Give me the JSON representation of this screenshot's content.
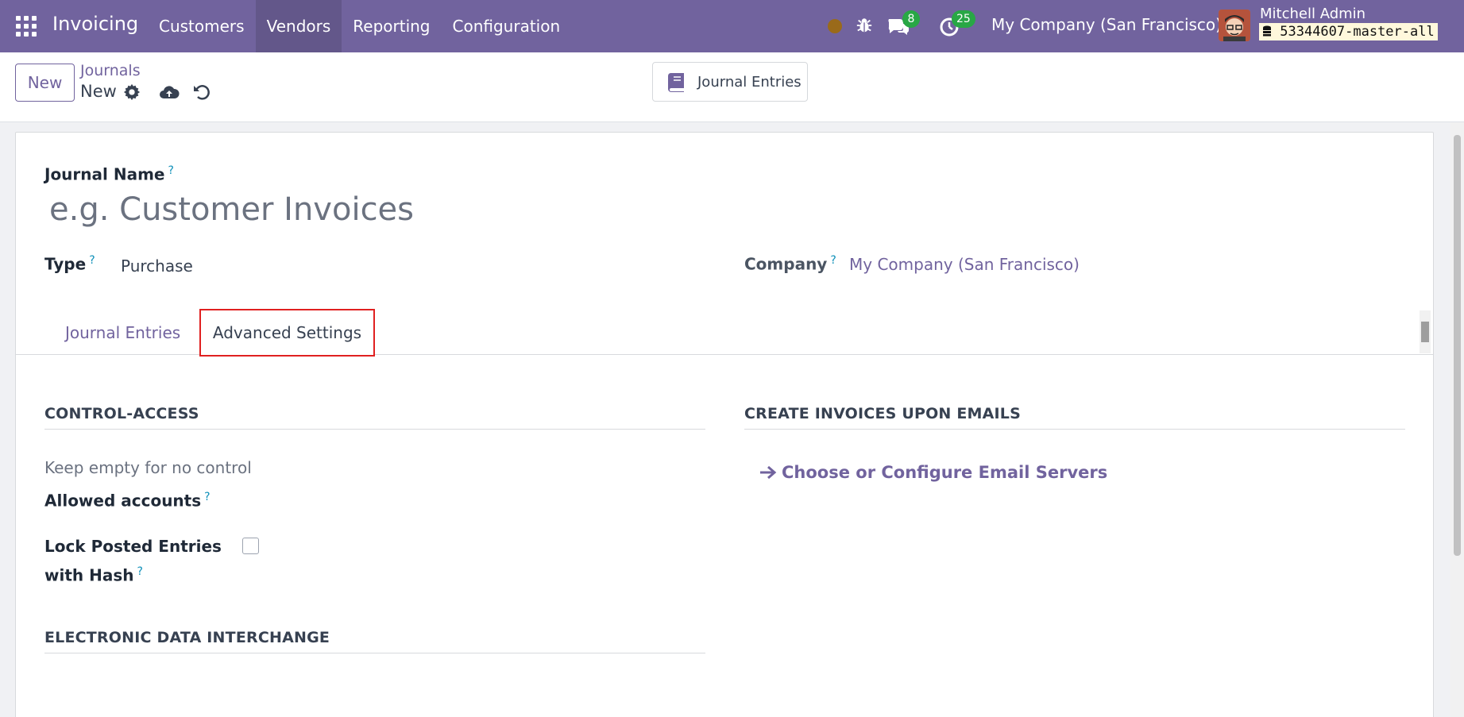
{
  "navbar": {
    "app_name": "Invoicing",
    "menu": [
      {
        "label": "Customers",
        "active": false
      },
      {
        "label": "Vendors",
        "active": true
      },
      {
        "label": "Reporting",
        "active": false
      },
      {
        "label": "Configuration",
        "active": false
      }
    ],
    "messages_count": "8",
    "activities_count": "25",
    "company": "My Company (San Francisco)",
    "user_name": "Mitchell Admin",
    "database": "53344607-master-all",
    "accent_color": "#71639e",
    "icons": [
      "apps-grid-icon",
      "status-dot-icon",
      "bug-icon",
      "chat-icon",
      "activity-clock-icon",
      "database-icon"
    ]
  },
  "control_panel": {
    "new_label": "New",
    "breadcrumb": "Journals",
    "record_name": "New",
    "smart_button_label": "Journal Entries",
    "icons": [
      "gear-icon",
      "cloud-upload-icon",
      "undo-icon",
      "book-icon"
    ]
  },
  "form": {
    "journal_name_label": "Journal Name",
    "journal_name_placeholder": "e.g. Customer Invoices",
    "help_marker": "?",
    "type_label": "Type",
    "type_value": "Purchase",
    "company_label": "Company",
    "company_value": "My Company (San Francisco)",
    "tabs": [
      {
        "label": "Journal Entries",
        "active": false
      },
      {
        "label": "Advanced Settings",
        "active": true,
        "highlighted": true
      }
    ],
    "control_access": {
      "title": "CONTROL-ACCESS",
      "help_text": "Keep empty for no control",
      "allowed_accounts_label": "Allowed accounts",
      "lock_label_line1": "Lock Posted Entries",
      "lock_label_line2": "with Hash",
      "lock_checked": false
    },
    "create_invoices": {
      "title": "CREATE INVOICES UPON EMAILS",
      "link_label": "Choose or Configure Email Servers"
    },
    "edi": {
      "title": "ELECTRONIC DATA INTERCHANGE"
    }
  }
}
